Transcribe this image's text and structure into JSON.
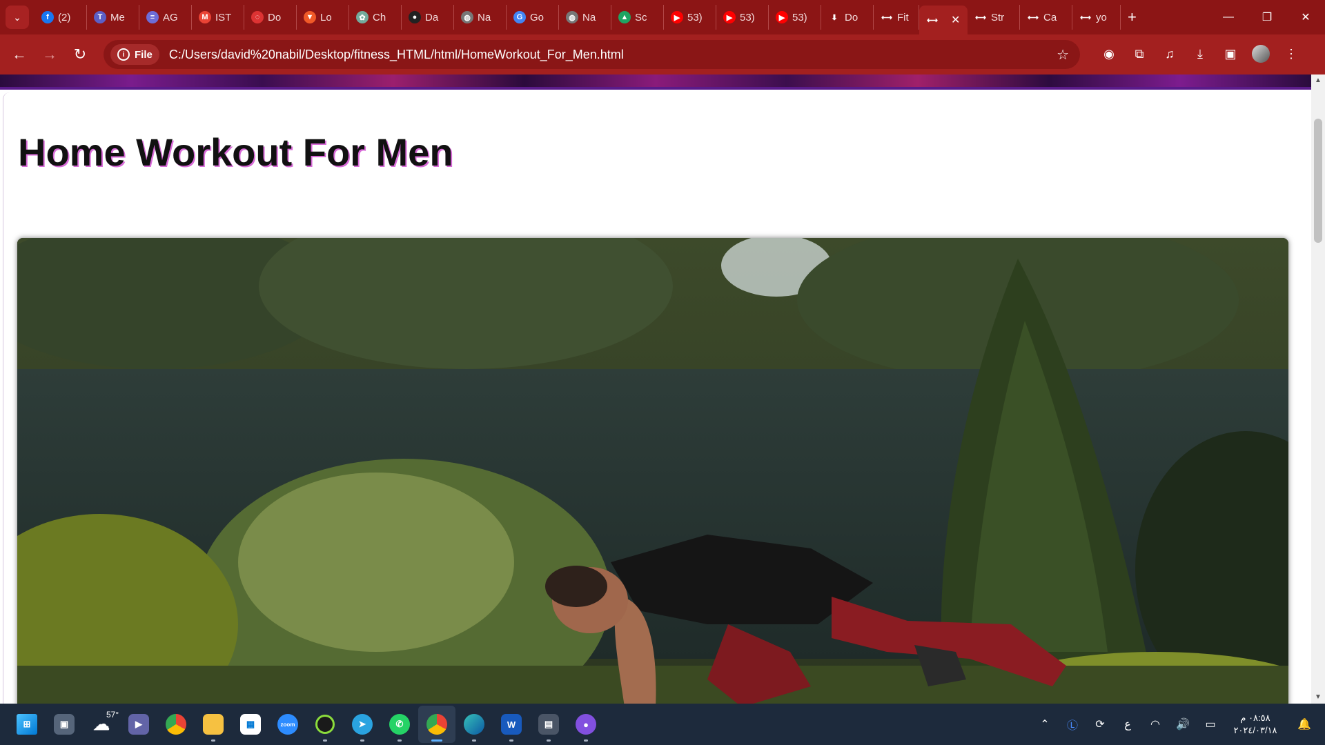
{
  "browser": {
    "tabs": [
      {
        "label": "(2)",
        "icon": "facebook-icon",
        "color": "#1877f2",
        "glyph": "f"
      },
      {
        "label": "Me",
        "icon": "teams-icon",
        "color": "#5b5fc7",
        "glyph": "T"
      },
      {
        "label": "AG",
        "icon": "circle-icon",
        "color": "#6d6dd8",
        "glyph": "≡"
      },
      {
        "label": "IST",
        "icon": "gmail-icon",
        "color": "#ea4335",
        "glyph": "M"
      },
      {
        "label": "Do",
        "icon": "dotted-circle-icon",
        "color": "#d33",
        "glyph": "◌"
      },
      {
        "label": "Lo",
        "icon": "brave-like-icon",
        "color": "#f05a28",
        "glyph": "▼"
      },
      {
        "label": "Ch",
        "icon": "chatgpt-icon",
        "color": "#74aa9c",
        "glyph": "✿"
      },
      {
        "label": "Da",
        "icon": "github-icon",
        "color": "#222",
        "glyph": "●"
      },
      {
        "label": "Na",
        "icon": "globe-icon",
        "color": "#777",
        "glyph": "◍"
      },
      {
        "label": "Go",
        "icon": "google-translate-icon",
        "color": "#4285f4",
        "glyph": "G"
      },
      {
        "label": "Na",
        "icon": "globe-icon",
        "color": "#777",
        "glyph": "◍"
      },
      {
        "label": "Sc",
        "icon": "google-drive-icon",
        "color": "#1fa463",
        "glyph": "▲"
      },
      {
        "label": "53)",
        "icon": "youtube-icon",
        "color": "#ff0000",
        "glyph": "▶"
      },
      {
        "label": "53)",
        "icon": "youtube-icon",
        "color": "#ff0000",
        "glyph": "▶"
      },
      {
        "label": "53)",
        "icon": "youtube-icon",
        "color": "#ff0000",
        "glyph": "▶"
      },
      {
        "label": "Do",
        "icon": "download-icon",
        "color": "transparent",
        "glyph": "⬇"
      },
      {
        "label": "Fit",
        "icon": "resize-icon",
        "color": "transparent",
        "glyph": "⟷"
      },
      {
        "label": "",
        "icon": "resize-icon",
        "color": "transparent",
        "glyph": "⟷",
        "active": true
      },
      {
        "label": "Str",
        "icon": "resize-icon",
        "color": "transparent",
        "glyph": "⟷"
      },
      {
        "label": "Ca",
        "icon": "resize-icon",
        "color": "transparent",
        "glyph": "⟷"
      },
      {
        "label": "yo",
        "icon": "resize-icon",
        "color": "transparent",
        "glyph": "⟷"
      }
    ],
    "chip_label": "File",
    "url": "C:/Users/david%20nabil/Desktop/fitness_HTML/html/HomeWorkout_For_Men.html"
  },
  "page": {
    "heading": "Home Workout For Men"
  },
  "taskbar": {
    "weather_temp": "57°",
    "clock_time": "٠٨:٥٨ م",
    "clock_date": "٢٠٢٤/٠٣/١٨",
    "lang": "ع"
  },
  "colors": {
    "frame": "#8c1515",
    "toolbar": "#a3201f",
    "omnibox": "#8a1616",
    "heading_shadow": "#d86ad8",
    "taskbar": "#1d2a3c"
  }
}
